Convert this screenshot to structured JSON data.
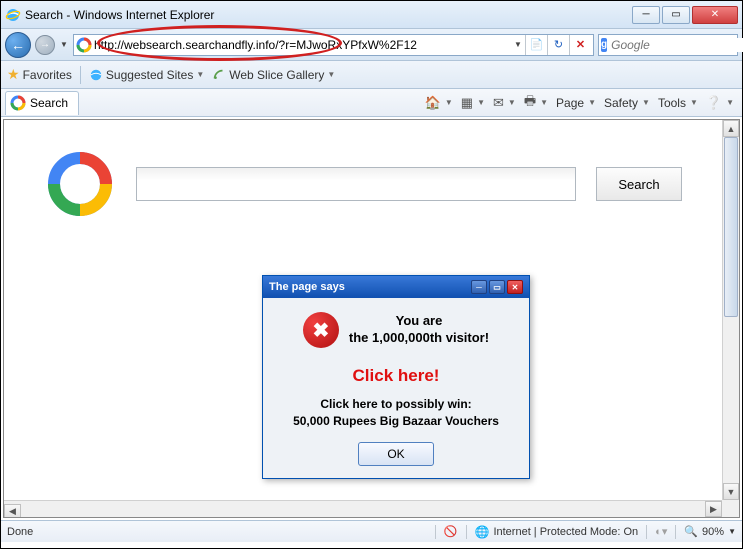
{
  "window": {
    "title": "Search - Windows Internet Explorer"
  },
  "nav": {
    "url": "http://websearch.searchandfly.info/?r=MJwoRxYPfxW%2F12",
    "search_placeholder": "Google"
  },
  "favbar": {
    "favorites_label": "Favorites",
    "suggested_label": "Suggested Sites",
    "webslice_label": "Web Slice Gallery"
  },
  "tab": {
    "label": "Search"
  },
  "cmd": {
    "page": "Page",
    "safety": "Safety",
    "tools": "Tools"
  },
  "page": {
    "search_button": "Search",
    "search_value": ""
  },
  "popup": {
    "title": "The page says",
    "line1": "You are",
    "line2": "the 1,000,000th visitor!",
    "click_here": "Click here!",
    "sub1": "Click here to possibly win:",
    "sub2": "50,000 Rupees Big Bazaar Vouchers",
    "ok": "OK"
  },
  "status": {
    "done": "Done",
    "zone": "Internet | Protected Mode: On",
    "zoom": "90%"
  }
}
